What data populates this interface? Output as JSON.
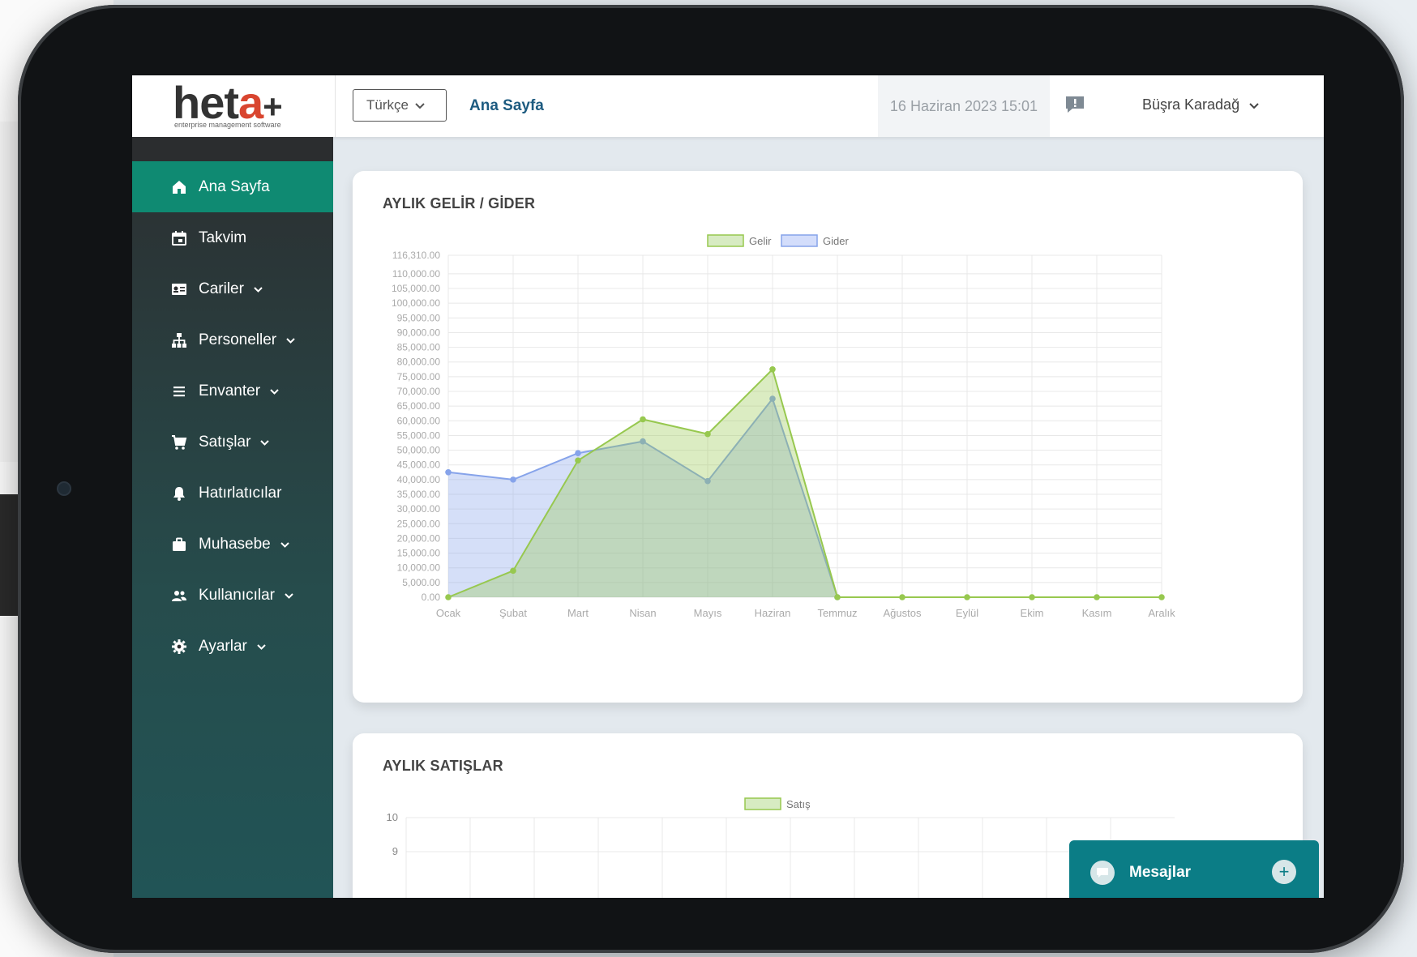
{
  "app": {
    "logo_text": "heta+",
    "logo_subtitle": "enterprise management software"
  },
  "header": {
    "language_label": "Türkçe",
    "breadcrumb": "Ana Sayfa",
    "datetime": "16 Haziran 2023 15:01",
    "user_name": "Büşra Karadağ"
  },
  "sidebar": {
    "items": [
      {
        "label": "Ana Sayfa",
        "icon": "home-icon",
        "has_submenu": false,
        "active": true
      },
      {
        "label": "Takvim",
        "icon": "calendar-icon",
        "has_submenu": false,
        "active": false
      },
      {
        "label": "Cariler",
        "icon": "contact-card-icon",
        "has_submenu": true,
        "active": false
      },
      {
        "label": "Personeller",
        "icon": "org-chart-icon",
        "has_submenu": true,
        "active": false
      },
      {
        "label": "Envanter",
        "icon": "list-icon",
        "has_submenu": true,
        "active": false
      },
      {
        "label": "Satışlar",
        "icon": "cart-icon",
        "has_submenu": true,
        "active": false
      },
      {
        "label": "Hatırlatıcılar",
        "icon": "bell-icon",
        "has_submenu": false,
        "active": false
      },
      {
        "label": "Muhasebe",
        "icon": "briefcase-icon",
        "has_submenu": true,
        "active": false
      },
      {
        "label": "Kullanıcılar",
        "icon": "users-icon",
        "has_submenu": true,
        "active": false
      },
      {
        "label": "Ayarlar",
        "icon": "gear-icon",
        "has_submenu": true,
        "active": false
      }
    ]
  },
  "cards": {
    "income_expense_title": "AYLIK GELİR / GİDER",
    "sales_title": "AYLIK SATIŞLAR"
  },
  "messages_widget": {
    "label": "Mesajlar"
  },
  "colors": {
    "sidebar_active": "#0f8a72",
    "breadcrumb": "#1d5b80",
    "income_fill": "#d7ebc2",
    "income_line": "#97c84f",
    "expense_fill": "#d3ddfb",
    "expense_line": "#86a3ea",
    "messages_bg": "#0b7d86"
  },
  "chart_data": [
    {
      "type": "area",
      "title": "AYLIK GELİR / GİDER",
      "categories": [
        "Ocak",
        "Şubat",
        "Mart",
        "Nisan",
        "Mayıs",
        "Haziran",
        "Temmuz",
        "Ağustos",
        "Eylül",
        "Ekim",
        "Kasım",
        "Aralık"
      ],
      "series": [
        {
          "name": "Gelir",
          "values": [
            0,
            9000,
            46500,
            60500,
            55500,
            77500,
            0,
            0,
            0,
            0,
            0,
            0
          ]
        },
        {
          "name": "Gider",
          "values": [
            42500,
            40000,
            49000,
            53000,
            39500,
            67500,
            0,
            null,
            null,
            null,
            null,
            null
          ]
        }
      ],
      "yticks": [
        "116,310.00",
        "110,000.00",
        "105,000.00",
        "100,000.00",
        "95,000.00",
        "90,000.00",
        "85,000.00",
        "80,000.00",
        "75,000.00",
        "70,000.00",
        "65,000.00",
        "60,000.00",
        "55,000.00",
        "50,000.00",
        "45,000.00",
        "40,000.00",
        "35,000.00",
        "30,000.00",
        "25,000.00",
        "20,000.00",
        "15,000.00",
        "10,000.00",
        "5,000.00",
        "0.00"
      ],
      "ylim": [
        0,
        116310
      ],
      "grid": true,
      "legend": "top-center"
    },
    {
      "type": "area",
      "title": "AYLIK SATIŞLAR",
      "series": [
        {
          "name": "Satış",
          "values": []
        }
      ],
      "yticks": [
        "10",
        "9"
      ],
      "grid": true,
      "legend": "top-center"
    }
  ]
}
